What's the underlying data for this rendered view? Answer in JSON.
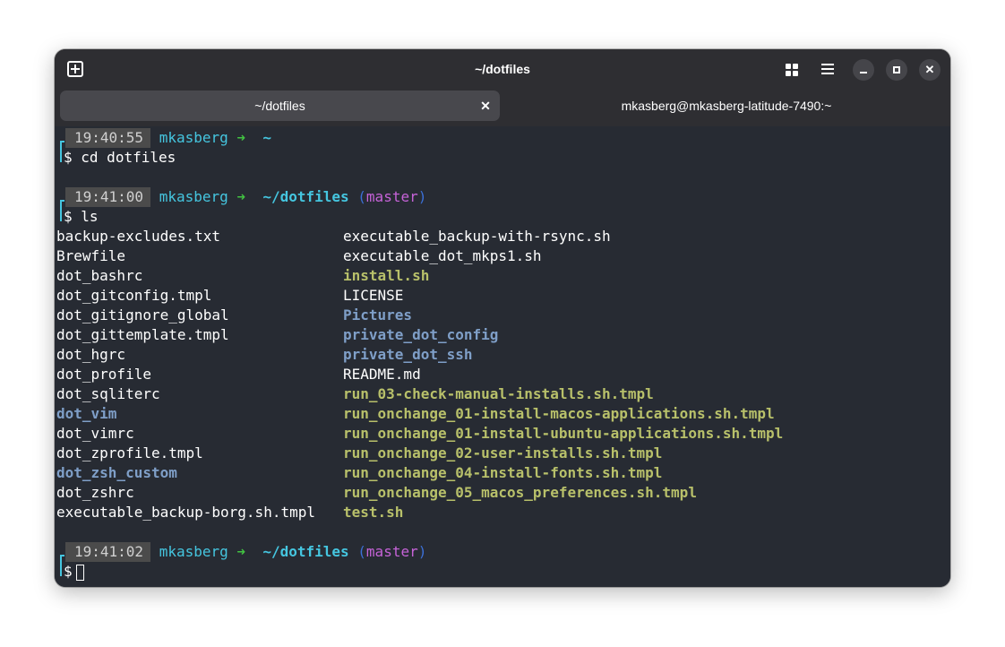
{
  "window": {
    "title": "~/dotfiles",
    "tabs": [
      {
        "label": "~/dotfiles",
        "active": true
      },
      {
        "label": "mkasberg@mkasberg-latitude-7490:~",
        "active": false
      }
    ]
  },
  "icons": {
    "new_tab": "new-tab-icon",
    "grid": "grid-view-icon",
    "menu": "hamburger-menu-icon",
    "minimize": "minimize-icon",
    "maximize": "maximize-icon",
    "close": "close-icon",
    "close_glyph": "✕"
  },
  "colors": {
    "background": "#272b33",
    "user": "#45c6e0",
    "arrow": "#42c342",
    "branch": "#c663d8",
    "directory": "#7f9fc8",
    "executable": "#b8c06a"
  },
  "prompts": [
    {
      "time": "19:40:55",
      "user": "mkasberg",
      "arrow": "➜",
      "path": "~",
      "branch": "",
      "command": "cd dotfiles"
    },
    {
      "time": "19:41:00",
      "user": "mkasberg",
      "arrow": "➜",
      "path": "~/dotfiles",
      "branch": "master",
      "command": "ls"
    },
    {
      "time": "19:41:02",
      "user": "mkasberg",
      "arrow": "➜",
      "path": "~/dotfiles",
      "branch": "master",
      "command": ""
    }
  ],
  "prompt_symbol": "$",
  "paren_open": "(",
  "paren_close": ")",
  "ls_output": {
    "col1": [
      {
        "name": "backup-excludes.txt",
        "type": "file"
      },
      {
        "name": "Brewfile",
        "type": "file"
      },
      {
        "name": "dot_bashrc",
        "type": "file"
      },
      {
        "name": "dot_gitconfig.tmpl",
        "type": "file"
      },
      {
        "name": "dot_gitignore_global",
        "type": "file"
      },
      {
        "name": "dot_gittemplate.tmpl",
        "type": "file"
      },
      {
        "name": "dot_hgrc",
        "type": "file"
      },
      {
        "name": "dot_profile",
        "type": "file"
      },
      {
        "name": "dot_sqliterc",
        "type": "file"
      },
      {
        "name": "dot_vim",
        "type": "dir"
      },
      {
        "name": "dot_vimrc",
        "type": "file"
      },
      {
        "name": "dot_zprofile.tmpl",
        "type": "file"
      },
      {
        "name": "dot_zsh_custom",
        "type": "dir"
      },
      {
        "name": "dot_zshrc",
        "type": "file"
      },
      {
        "name": "executable_backup-borg.sh.tmpl",
        "type": "file"
      }
    ],
    "col2": [
      {
        "name": "executable_backup-with-rsync.sh",
        "type": "file"
      },
      {
        "name": "executable_dot_mkps1.sh",
        "type": "file"
      },
      {
        "name": "install.sh",
        "type": "exe"
      },
      {
        "name": "LICENSE",
        "type": "file"
      },
      {
        "name": "Pictures",
        "type": "dir"
      },
      {
        "name": "private_dot_config",
        "type": "dir"
      },
      {
        "name": "private_dot_ssh",
        "type": "dir"
      },
      {
        "name": "README.md",
        "type": "file"
      },
      {
        "name": "run_03-check-manual-installs.sh.tmpl",
        "type": "exe"
      },
      {
        "name": "run_onchange_01-install-macos-applications.sh.tmpl",
        "type": "exe"
      },
      {
        "name": "run_onchange_01-install-ubuntu-applications.sh.tmpl",
        "type": "exe"
      },
      {
        "name": "run_onchange_02-user-installs.sh.tmpl",
        "type": "exe"
      },
      {
        "name": "run_onchange_04-install-fonts.sh.tmpl",
        "type": "exe"
      },
      {
        "name": "run_onchange_05_macos_preferences.sh.tmpl",
        "type": "exe"
      },
      {
        "name": "test.sh",
        "type": "exe"
      }
    ]
  }
}
